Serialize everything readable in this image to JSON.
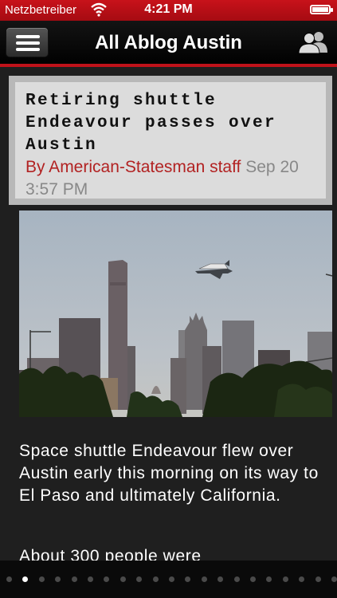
{
  "status_bar": {
    "carrier": "Netzbetreiber",
    "time": "4:21 PM"
  },
  "nav": {
    "title": "All Ablog Austin",
    "menu_icon": "hamburger-menu-icon",
    "profile_icon": "people-icon"
  },
  "colors": {
    "accent": "#c0121a",
    "background": "#1f1f1f",
    "author": "#b22222"
  },
  "article": {
    "headline": "Retiring shuttle Endeavour passes over Austin",
    "author": "By American-Statesman staff",
    "date": "Sep 20 3:57 PM",
    "paragraphs": [
      "Space shuttle Endeavour flew over Austin early this morning on its way to El Paso and ultimately California.",
      "About 300 people were"
    ]
  },
  "pager": {
    "page_count": 21,
    "current_page": 2
  }
}
